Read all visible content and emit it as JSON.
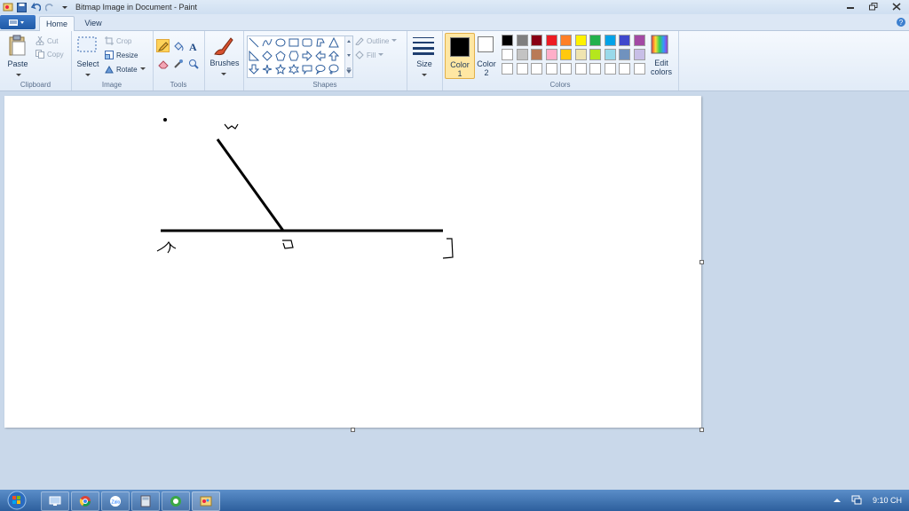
{
  "window": {
    "title": "Bitmap Image in Document - Paint"
  },
  "tabs": [
    {
      "label": "Home"
    },
    {
      "label": "View"
    }
  ],
  "clipboard": {
    "paste": "Paste",
    "cut": "Cut",
    "copy": "Copy",
    "group": "Clipboard"
  },
  "image": {
    "select": "Select",
    "crop": "Crop",
    "resize": "Resize",
    "rotate": "Rotate",
    "group": "Image"
  },
  "tools": {
    "group": "Tools"
  },
  "brushes": {
    "label": "Brushes"
  },
  "shapes": {
    "outline": "Outline",
    "fill": "Fill",
    "group": "Shapes"
  },
  "size": {
    "label": "Size"
  },
  "colors": {
    "color1_label": "Color",
    "color1_num": "1",
    "color2_label": "Color",
    "color2_num": "2",
    "edit_label_1": "Edit",
    "edit_label_2": "colors",
    "group": "Colors",
    "color1": "#000000",
    "color2": "#ffffff",
    "palette_row1": [
      "#000000",
      "#7f7f7f",
      "#880015",
      "#ed1c24",
      "#ff7f27",
      "#fff200",
      "#22b14c",
      "#00a2e8",
      "#3f48cc",
      "#a349a4"
    ],
    "palette_row2": [
      "#ffffff",
      "#c3c3c3",
      "#b97a57",
      "#ffaec9",
      "#ffc90e",
      "#efe4b0",
      "#b5e61d",
      "#99d9ea",
      "#7092be",
      "#c8bfe7"
    ],
    "palette_row3": [
      "#ffffff",
      "#ffffff",
      "#ffffff",
      "#ffffff",
      "#ffffff",
      "#ffffff",
      "#ffffff",
      "#ffffff",
      "#ffffff",
      "#ffffff"
    ]
  },
  "taskbar": {
    "clock": "9:10 CH"
  }
}
